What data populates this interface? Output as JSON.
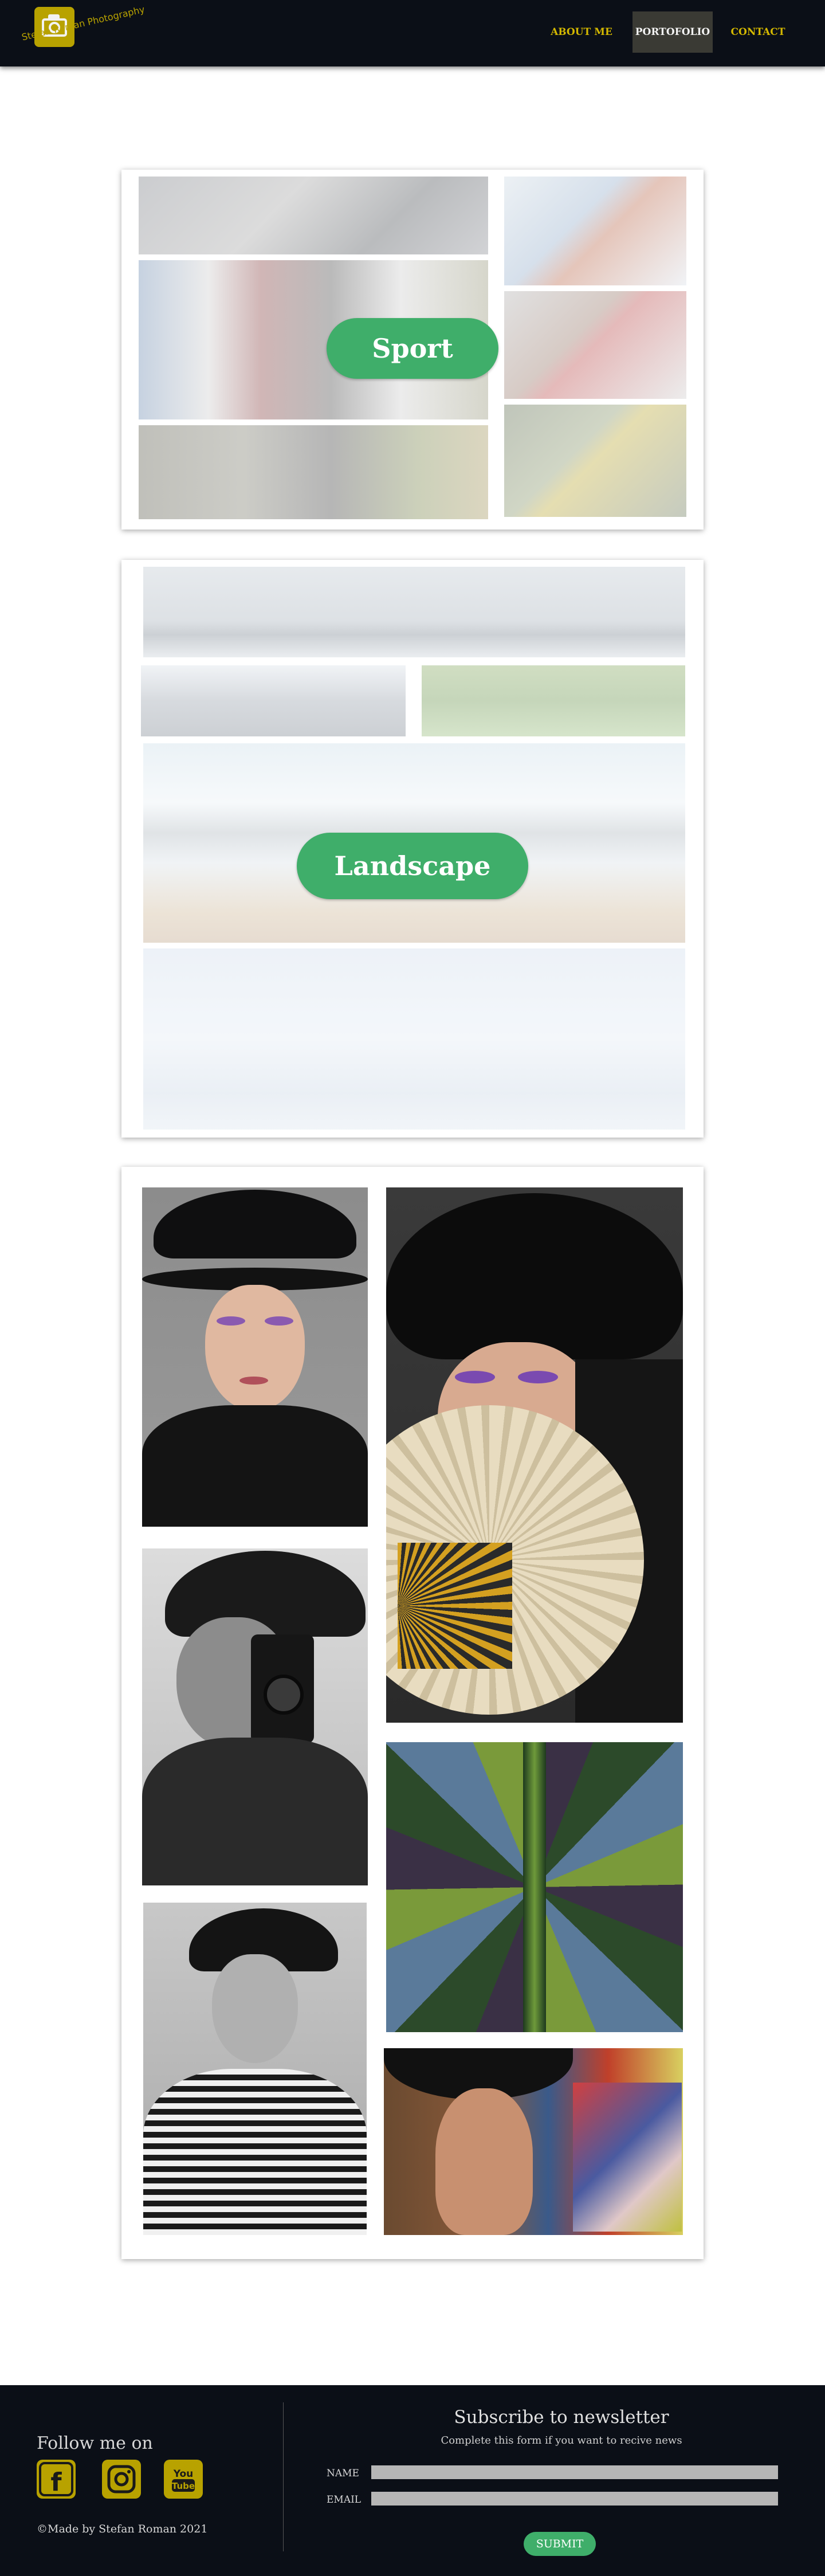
{
  "header": {
    "logo_text": "Stefan Roman Photography",
    "logo_icon": "camera-icon",
    "nav": {
      "about_label": "ABOUT ME",
      "portfolio_label": "PORTOFOLIO",
      "contact_label": "CONTACT"
    }
  },
  "portfolio": {
    "sport_label": "Sport",
    "landscape_label": "Landscape"
  },
  "footer": {
    "follow_title": "Follow me on",
    "social": {
      "facebook_icon": "facebook-icon",
      "facebook_letter": "f",
      "instagram_icon": "instagram-icon",
      "youtube_icon": "youtube-icon",
      "youtube_text": "You Tube"
    },
    "made_by": "©Made by Stefan Roman 2021",
    "newsletter": {
      "title": "Subscribe to newsletter",
      "subtitle": "Complete this form if you want to recive news",
      "name_label": "NAME",
      "email_label": "EMAIL",
      "submit_label": "SUBMIT"
    }
  },
  "colors": {
    "navbar_bg": "#0b0f17",
    "accent_gold": "#b8a200",
    "accent_green": "#3fae6a",
    "active_nav_bg": "#3a3a34"
  }
}
